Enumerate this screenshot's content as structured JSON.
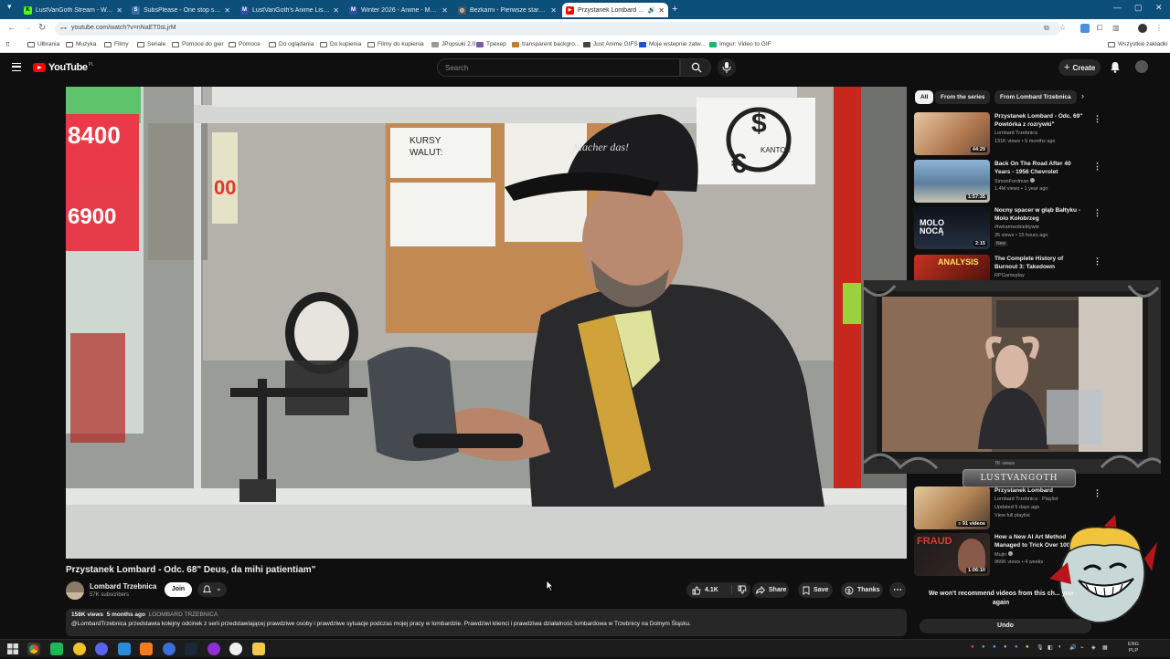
{
  "browser": {
    "tabs": [
      {
        "label": "LustVanGoth Stream - Watch Li",
        "fav_color": "#53fc18",
        "fav_glyph": "K"
      },
      {
        "label": "SubsPlease - One stop shop fo",
        "fav_color": "#3b6ea5",
        "fav_glyph": "S"
      },
      {
        "label": "LustVanGoth's Anime List - My",
        "fav_color": "#2e51a2",
        "fav_glyph": "M"
      },
      {
        "label": "Winter 2026 - Anime - MyAnim",
        "fav_color": "#2e51a2",
        "fav_glyph": "M"
      },
      {
        "label": "Bezkarni - Pierwsze starcie / Th",
        "fav_color": "#555555",
        "fav_glyph": "◎"
      },
      {
        "label": "Przystanek Lombard - Odc",
        "fav_color": "#ff0000",
        "fav_glyph": "▶"
      }
    ],
    "url": "youtube.com/watch?v=nNaET0sLjrM",
    "bookmarks": [
      "Ułbrania",
      "Muzyka",
      "Filmy",
      "Seriale",
      "Pomoce do gier",
      "Pomoce",
      "Do oglądania",
      "Do kupienia",
      "Filmy do kupienia",
      "JPopsuki 2.0",
      "Tpexep",
      "transparent backgro...",
      "Just Anime GIFS",
      "Moje wstepnie zatw...",
      "Imgur: Video to GIF"
    ],
    "bookmarks_right": "Wszystkie zakładki"
  },
  "header": {
    "logo_text": "YouTube",
    "country": "PL",
    "search_placeholder": "Search",
    "create_label": "Create"
  },
  "video": {
    "title": "Przystanek Lombard - Odc. 68\" Deus, da mihi patientiam\"",
    "channel": "Lombard Trzebnica",
    "subscribers": "57K subscribers",
    "join_label": "Join",
    "likes": "4.1K",
    "share_label": "Share",
    "save_label": "Save",
    "thanks_label": "Thanks",
    "views": "158K views",
    "age": "5 months ago",
    "hashtag": "LOOMBARD TRZEBNICA",
    "description": "@LombardTrzebnica przedstawia kolejny odcinek z serii przedstawiającej prawdziwe osoby i prawdziwe sytuacje podczas mojej pracy w lombardzie. Prawdziwi klienci i prawdziwa działalność lombardowa w Trzebnicy na Dolnym Śląsku."
  },
  "scene_text": {
    "sign_kursy": "KURSY\nWALUT:",
    "sign_kantor": "KANTOR",
    "cap_text": "Macher das!",
    "promo_1": "8400",
    "promo_2": "6900",
    "promo_3": "00"
  },
  "chips": [
    "All",
    "From the series",
    "From Lombard Trzebnica"
  ],
  "recommendations": [
    {
      "title": "Przystanek Lombard - Odc. 69\" Powtórka z rozrywki\"",
      "channel": "Lombard Trzebnica",
      "meta": "131K views • 5 months ago",
      "duration": "44:29",
      "thumb": "#c9a27a"
    },
    {
      "title": "Back On The Road After 40 Years - 1956 Chevrolet",
      "channel": "SimonFordman",
      "meta": "1.4M views • 1 year ago",
      "duration": "1:57:35",
      "thumb": "#6b8fb5"
    },
    {
      "title": "Nocny spacer w głąb Bałtyku - Molo Kołobrzeg",
      "channel": "#twiramwobiektywie",
      "meta": "35 views • 15 hours ago",
      "badge": "New",
      "duration": "2:15",
      "thumb": "#1e2430"
    },
    {
      "title": "The Complete History of Burnout 3: Takedown",
      "channel": "RPGameplay",
      "meta": "",
      "duration": "",
      "thumb": "#b52a1a"
    }
  ],
  "playlist": {
    "title": "Przystanek Lombard",
    "channel": "Lombard Trzebnica · Playlist",
    "updated": "Updated 5 days ago",
    "link": "View full playlist",
    "count": "91 videos",
    "partial_top": "7K views"
  },
  "rec_last": {
    "title": "How a New AI Art Method Managed to Trick Over 100k",
    "channel": "Mujin",
    "meta": "966K views • 4 weeks",
    "duration": "1:06:10",
    "thumb_text": "FRAUD"
  },
  "dismiss": {
    "message": "We won't recommend videos from this ch... you again",
    "undo": "Undo"
  },
  "webcam": {
    "name_plate": "LUSTVANGOTH"
  },
  "taskbar": {
    "lang_top": "ENG",
    "lang_bottom": "PLP"
  }
}
